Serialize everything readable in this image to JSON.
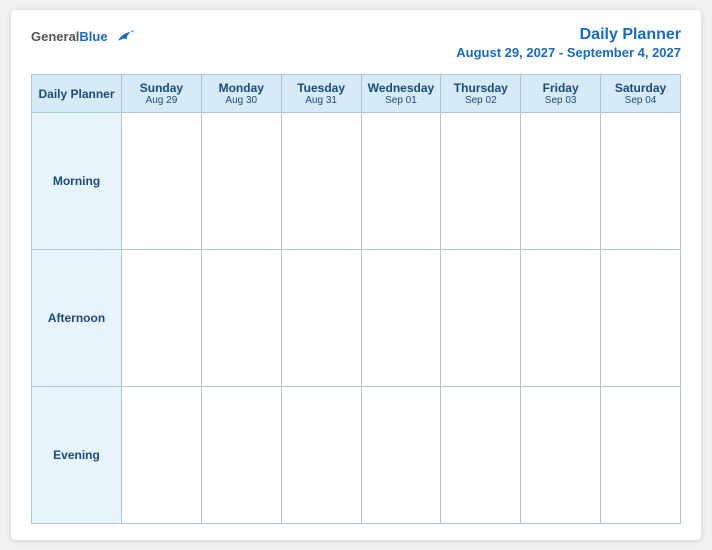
{
  "header": {
    "logo_general": "General",
    "logo_blue": "Blue",
    "main_title": "Daily Planner",
    "date_range": "August 29, 2027 - September 4, 2027"
  },
  "table": {
    "label_column": "Daily Planner",
    "days": [
      {
        "name": "Sunday",
        "date": "Aug 29"
      },
      {
        "name": "Monday",
        "date": "Aug 30"
      },
      {
        "name": "Tuesday",
        "date": "Aug 31"
      },
      {
        "name": "Wednesday",
        "date": "Sep 01"
      },
      {
        "name": "Thursday",
        "date": "Sep 02"
      },
      {
        "name": "Friday",
        "date": "Sep 03"
      },
      {
        "name": "Saturday",
        "date": "Sep 04"
      }
    ],
    "rows": [
      {
        "label": "Morning"
      },
      {
        "label": "Afternoon"
      },
      {
        "label": "Evening"
      }
    ]
  }
}
